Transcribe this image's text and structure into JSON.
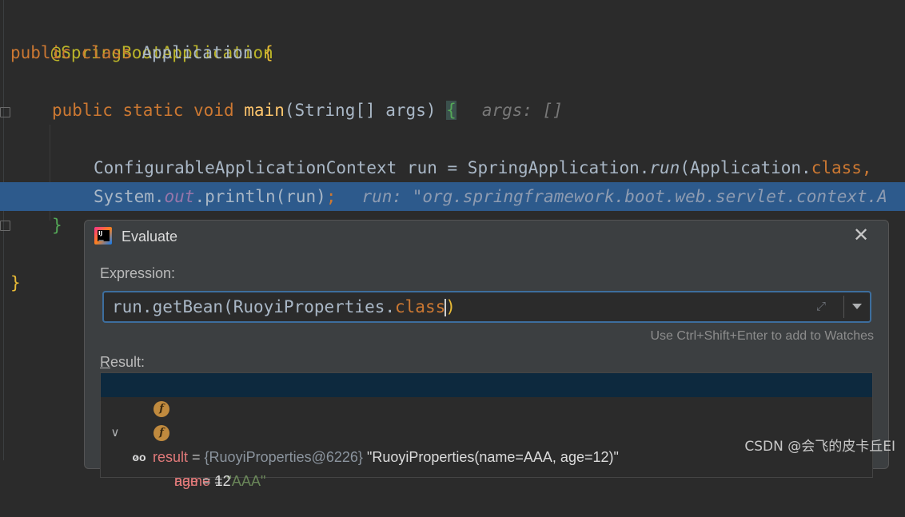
{
  "editor": {
    "annotation": "@SpringBootApplication",
    "line2": {
      "kw1": "public",
      "kw2": "class",
      "name": "Application",
      "brace": "{"
    },
    "line4": {
      "kw1": "public",
      "kw2": "static",
      "kw3": "void",
      "fn": "main",
      "params": "(String[] args)",
      "brace": "{",
      "hint": "args: []"
    },
    "line6": {
      "type": "ConfigurableApplicationContext",
      "rest": " run = SpringApplication.",
      "fn": "run",
      "args": "(Application.",
      "kw": "class",
      "tail": ","
    },
    "line7": {
      "obj": "System.",
      "field": "out",
      "call": ".println(run)",
      "semi": ";",
      "hint": "run: \"org.springframework.boot.web.servlet.context.A"
    },
    "line8": {
      "brace": "}"
    },
    "line10": {
      "brace": "}"
    }
  },
  "dialog": {
    "title": "Evaluate",
    "close_icon": "close-icon",
    "expression_label": "Expression:",
    "expression": {
      "part1": "run.getBean(RuoyiProperties.",
      "kw": "class",
      "part2": ")"
    },
    "watch_hint": "Use Ctrl+Shift+Enter to add to Watches",
    "result_label_first": "R",
    "result_label_rest": "esult:",
    "result": {
      "name": "result",
      "eq": " = ",
      "type": "{RuoyiProperties@6226}",
      "value": " \"RuoyiProperties(name=AAA, age=12)\"",
      "children": [
        {
          "name": "name",
          "eq": " = ",
          "value": "\"AAA\""
        },
        {
          "name": "age",
          "eq": " = ",
          "value": "12"
        }
      ]
    }
  },
  "watermark": "CSDN @会飞的皮卡丘EI"
}
